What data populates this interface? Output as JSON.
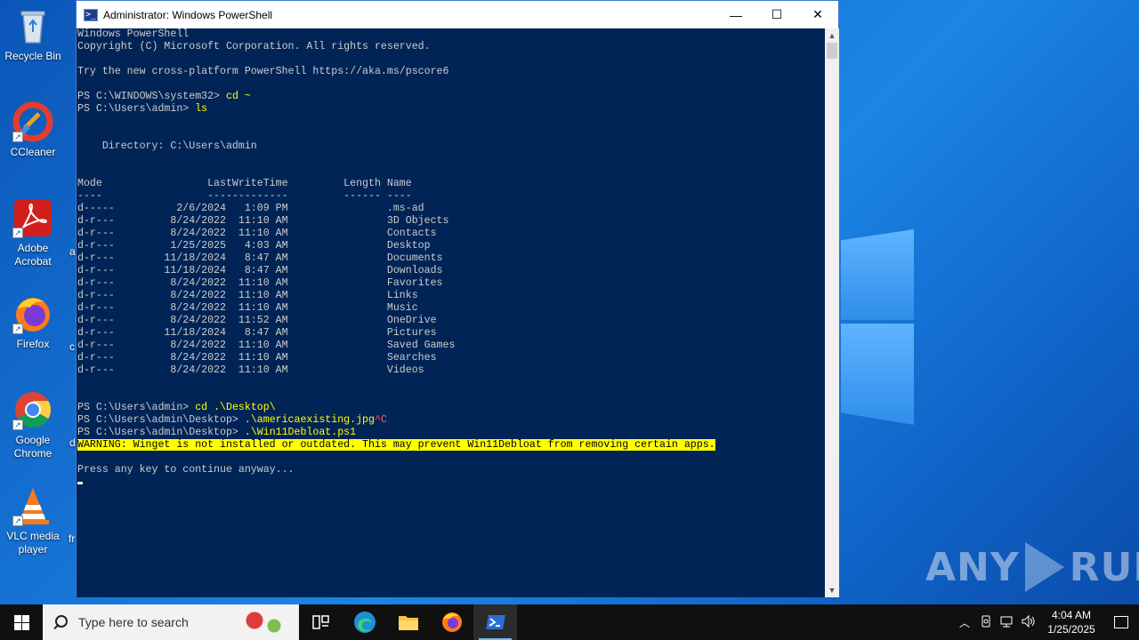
{
  "desktop": {
    "icons": [
      {
        "label": "Recycle Bin",
        "icon": "recycle-bin-icon"
      },
      {
        "label": "CCleaner",
        "icon": "ccleaner-icon"
      },
      {
        "label": "Adobe Acrobat",
        "icon": "adobe-acrobat-icon"
      },
      {
        "label": "Firefox",
        "icon": "firefox-icon"
      },
      {
        "label": "Google Chrome",
        "icon": "chrome-icon"
      },
      {
        "label": "VLC media player",
        "icon": "vlc-icon"
      }
    ],
    "edge_letters": [
      "a",
      "c",
      "d",
      "fr"
    ],
    "watermark": {
      "left": "ANY",
      "right": "RUN"
    }
  },
  "window": {
    "title": "Administrator: Windows PowerShell",
    "controls": {
      "minimize": "—",
      "maximize": "☐",
      "close": "✕"
    }
  },
  "console": {
    "lines": [
      {
        "text": "Windows PowerShell"
      },
      {
        "text": "Copyright (C) Microsoft Corporation. All rights reserved."
      },
      {
        "text": ""
      },
      {
        "text": "Try the new cross-platform PowerShell https://aka.ms/pscore6"
      },
      {
        "text": ""
      },
      {
        "prompt": "PS C:\\WINDOWS\\system32> ",
        "cmd": "cd ~"
      },
      {
        "prompt": "PS C:\\Users\\admin> ",
        "cmd": "ls"
      },
      {
        "text": ""
      },
      {
        "text": ""
      },
      {
        "text": "    Directory: C:\\Users\\admin"
      },
      {
        "text": ""
      },
      {
        "text": ""
      },
      {
        "text": "Mode                 LastWriteTime         Length Name"
      },
      {
        "text": "----                 -------------         ------ ----"
      },
      {
        "text": "d-----          2/6/2024   1:09 PM                .ms-ad"
      },
      {
        "text": "d-r---         8/24/2022  11:10 AM                3D Objects"
      },
      {
        "text": "d-r---         8/24/2022  11:10 AM                Contacts"
      },
      {
        "text": "d-r---         1/25/2025   4:03 AM                Desktop"
      },
      {
        "text": "d-r---        11/18/2024   8:47 AM                Documents"
      },
      {
        "text": "d-r---        11/18/2024   8:47 AM                Downloads"
      },
      {
        "text": "d-r---         8/24/2022  11:10 AM                Favorites"
      },
      {
        "text": "d-r---         8/24/2022  11:10 AM                Links"
      },
      {
        "text": "d-r---         8/24/2022  11:10 AM                Music"
      },
      {
        "text": "d-r---         8/24/2022  11:52 AM                OneDrive"
      },
      {
        "text": "d-r---        11/18/2024   8:47 AM                Pictures"
      },
      {
        "text": "d-r---         8/24/2022  11:10 AM                Saved Games"
      },
      {
        "text": "d-r---         8/24/2022  11:10 AM                Searches"
      },
      {
        "text": "d-r---         8/24/2022  11:10 AM                Videos"
      },
      {
        "text": ""
      },
      {
        "text": ""
      },
      {
        "prompt": "PS C:\\Users\\admin> ",
        "cmd": "cd .\\Desktop\\"
      },
      {
        "prompt": "PS C:\\Users\\admin\\Desktop> ",
        "cmd": ".\\americaexisting.jpg",
        "red": "^C"
      },
      {
        "prompt": "PS C:\\Users\\admin\\Desktop> ",
        "cmd": ".\\Win11Debloat.ps1"
      },
      {
        "warn": "WARNING: Winget is not installed or outdated. This may prevent Win11Debloat from removing certain apps."
      },
      {
        "text": ""
      },
      {
        "text": "Press any key to continue anyway..."
      }
    ]
  },
  "taskbar": {
    "search_placeholder": "Type here to search",
    "apps": [
      "task-view-icon",
      "edge-icon",
      "file-explorer-icon",
      "firefox-icon",
      "powershell-icon"
    ],
    "tray_icons": [
      "chevron-up-icon",
      "device-icon",
      "network-icon",
      "volume-icon"
    ],
    "time": "4:04 AM",
    "date": "1/25/2025"
  }
}
